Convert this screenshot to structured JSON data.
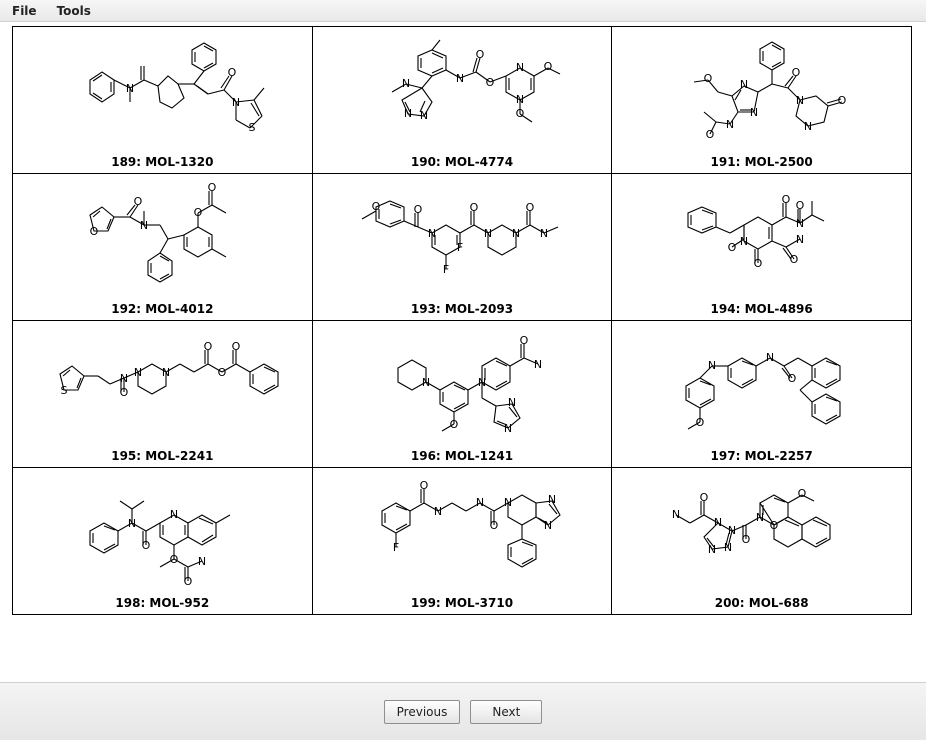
{
  "menu": {
    "file": "File",
    "tools": "Tools"
  },
  "navigation": {
    "previous": "Previous",
    "next": "Next"
  },
  "molecules": [
    {
      "index": 189,
      "id": "MOL-1320",
      "label": "189: MOL-1320"
    },
    {
      "index": 190,
      "id": "MOL-4774",
      "label": "190: MOL-4774"
    },
    {
      "index": 191,
      "id": "MOL-2500",
      "label": "191: MOL-2500"
    },
    {
      "index": 192,
      "id": "MOL-4012",
      "label": "192: MOL-4012"
    },
    {
      "index": 193,
      "id": "MOL-2093",
      "label": "193: MOL-2093"
    },
    {
      "index": 194,
      "id": "MOL-4896",
      "label": "194: MOL-4896"
    },
    {
      "index": 195,
      "id": "MOL-2241",
      "label": "195: MOL-2241"
    },
    {
      "index": 196,
      "id": "MOL-1241",
      "label": "196: MOL-1241"
    },
    {
      "index": 197,
      "id": "MOL-2257",
      "label": "197: MOL-2257"
    },
    {
      "index": 198,
      "id": "MOL-952",
      "label": "198: MOL-952"
    },
    {
      "index": 199,
      "id": "MOL-3710",
      "label": "199: MOL-3710"
    },
    {
      "index": 200,
      "id": "MOL-688",
      "label": "200: MOL-688"
    }
  ]
}
